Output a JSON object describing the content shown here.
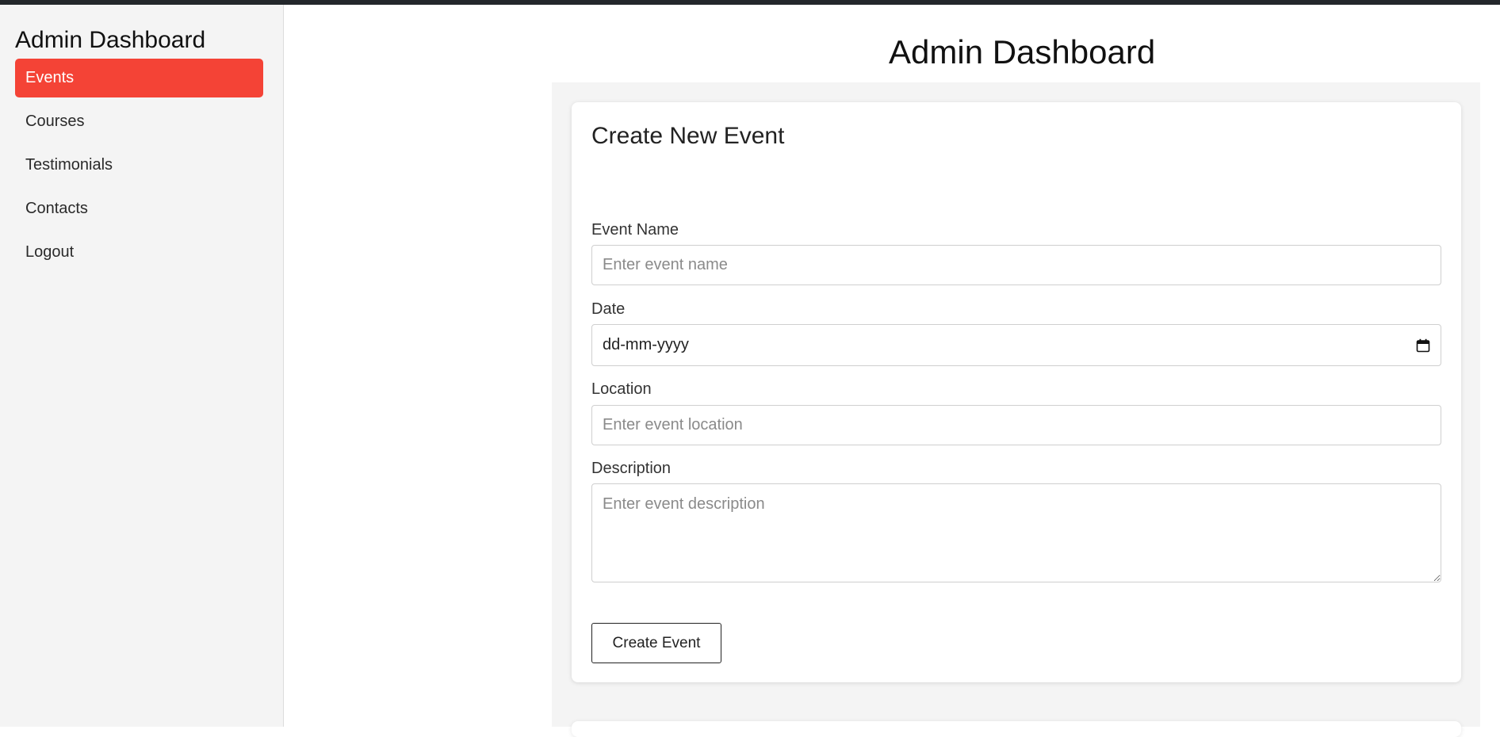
{
  "sidebar": {
    "title": "Admin Dashboard",
    "items": [
      {
        "label": "Events",
        "active": true
      },
      {
        "label": "Courses",
        "active": false
      },
      {
        "label": "Testimonials",
        "active": false
      },
      {
        "label": "Contacts",
        "active": false
      },
      {
        "label": "Logout",
        "active": false
      }
    ]
  },
  "header": {
    "title": "Admin Dashboard"
  },
  "form": {
    "title": "Create New Event",
    "event_name": {
      "label": "Event Name",
      "placeholder": "Enter event name",
      "value": ""
    },
    "date": {
      "label": "Date",
      "value": "dd-mm-yyyy"
    },
    "location": {
      "label": "Location",
      "placeholder": "Enter event location",
      "value": ""
    },
    "description": {
      "label": "Description",
      "placeholder": "Enter event description",
      "value": ""
    },
    "submit_label": "Create Event"
  },
  "colors": {
    "accent": "#f44336",
    "topbar": "#23272b",
    "sidebar_bg": "#f4f4f4",
    "content_bg": "#f4f4f4"
  },
  "icons": {
    "date_picker": "calendar-icon"
  }
}
